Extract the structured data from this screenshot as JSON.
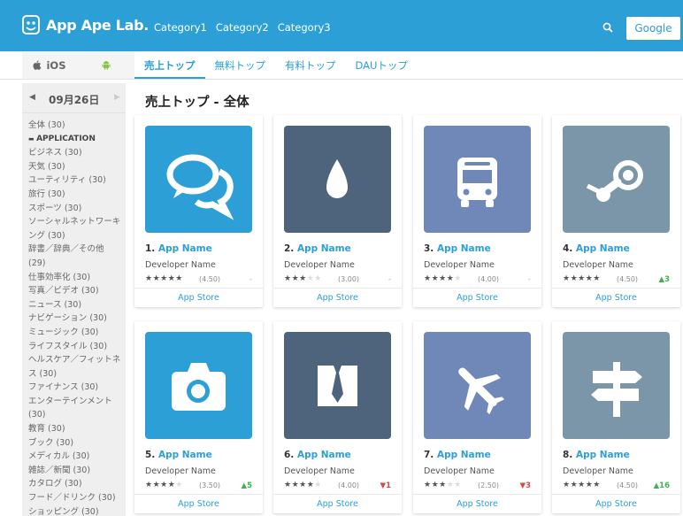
{
  "header": {
    "brand": "App Ape Lab.",
    "nav": [
      "Category1",
      "Category2",
      "Category3"
    ],
    "google_label": "Google"
  },
  "subnav": {
    "ios_label": "iOS",
    "tabs": [
      "売上トップ",
      "無料トップ",
      "有料トップ",
      "DAUトップ"
    ]
  },
  "sidebar": {
    "prev": "◀",
    "date": "09月26日",
    "next": "▶",
    "categories": [
      "全体 (30)",
      "APPLICATION",
      "ビジネス (30)",
      "天気 (30)",
      "ユーティリティ (30)",
      "旅行 (30)",
      "スポーツ (30)",
      "ソーシャルネットワーキング (30)",
      "辞書／辞典／その他 (29)",
      "仕事効率化 (30)",
      "写真／ビデオ (30)",
      "ニュース (30)",
      "ナビゲーション (30)",
      "ミュージック (30)",
      "ライフスタイル (30)",
      "ヘルスケア／フィットネス (30)",
      "ファイナンス (30)",
      "エンターテインメント (30)",
      "教育 (30)",
      "ブック (30)",
      "メディカル (30)",
      "雑誌／新聞 (30)",
      "カタログ (30)",
      "フード／ドリンク (30)",
      "ショッピング (30)"
    ]
  },
  "main": {
    "title": "売上トップ - 全体"
  },
  "apps": [
    {
      "rank": "1.",
      "name": "App Name",
      "developer": "Developer Name",
      "stars": "★★★★★",
      "stars_off": "",
      "score": "(4.50)",
      "change": "-",
      "change_type": "none",
      "store": "App Store",
      "icon": "chat-bubbles-icon",
      "color": "#2b9fd6"
    },
    {
      "rank": "2.",
      "name": "App Name",
      "developer": "Developer Name",
      "stars": "★★★",
      "stars_off": "★★",
      "score": "(3.00)",
      "change": "-",
      "change_type": "none",
      "store": "App Store",
      "icon": "water-drop-icon",
      "color": "#4e647c"
    },
    {
      "rank": "3.",
      "name": "App Name",
      "developer": "Developer Name",
      "stars": "★★★★",
      "stars_off": "★",
      "score": "(4.00)",
      "change": "-",
      "change_type": "none",
      "store": "App Store",
      "icon": "bus-icon",
      "color": "#6f88b8"
    },
    {
      "rank": "4.",
      "name": "App Name",
      "developer": "Developer Name",
      "stars": "★★★★★",
      "stars_off": "",
      "score": "(4.50)",
      "change": "▲3",
      "change_type": "up",
      "store": "App Store",
      "icon": "steam-icon",
      "color": "#7b96a8"
    },
    {
      "rank": "5.",
      "name": "App Name",
      "developer": "Developer Name",
      "stars": "★★★★",
      "stars_off": "★",
      "score": "(3.50)",
      "change": "▲5",
      "change_type": "up",
      "store": "App Store",
      "icon": "camera-icon",
      "color": "#2b9fd6"
    },
    {
      "rank": "6.",
      "name": "App Name",
      "developer": "Developer Name",
      "stars": "★★★★",
      "stars_off": "★",
      "score": "(4.00)",
      "change": "▼1",
      "change_type": "down",
      "store": "App Store",
      "icon": "necktie-icon",
      "color": "#4e647c"
    },
    {
      "rank": "7.",
      "name": "App Name",
      "developer": "Developer Name",
      "stars": "★★★",
      "stars_off": "★★",
      "score": "(2.50)",
      "change": "▼3",
      "change_type": "down",
      "store": "App Store",
      "icon": "airplane-icon",
      "color": "#6f88b8"
    },
    {
      "rank": "8.",
      "name": "App Name",
      "developer": "Developer Name",
      "stars": "★★★★★",
      "stars_off": "",
      "score": "(4.50)",
      "change": "▲16",
      "change_type": "up",
      "store": "App Store",
      "icon": "signpost-icon",
      "color": "#7b96a8"
    }
  ]
}
